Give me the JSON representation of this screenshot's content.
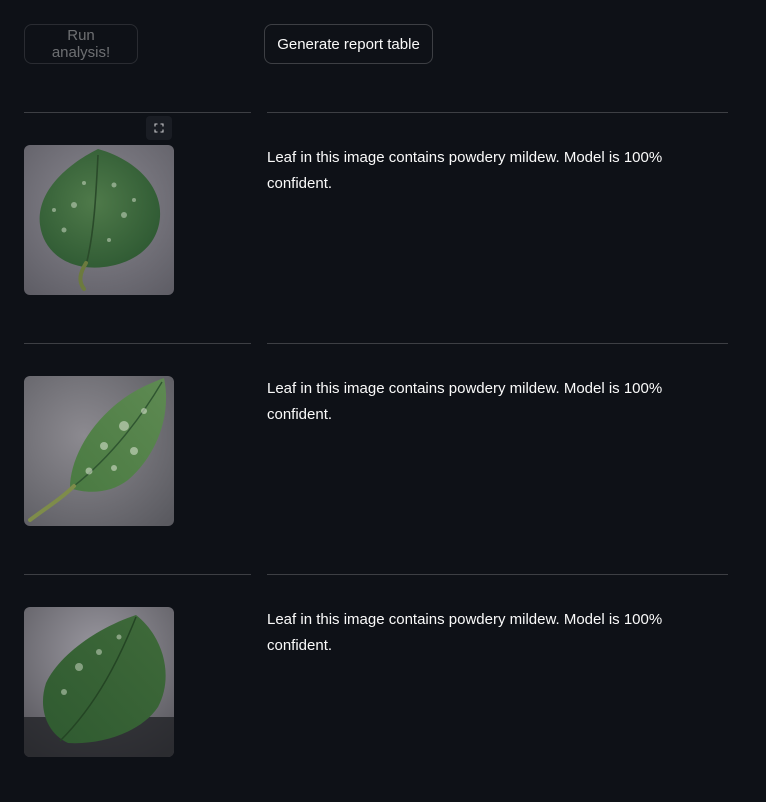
{
  "toolbar": {
    "run_label": "Run analysis!",
    "report_label": "Generate report table"
  },
  "results": [
    {
      "text": "Leaf in this image contains powdery mildew. Model is 100% confident.",
      "image_icon": "leaf-image"
    },
    {
      "text": "Leaf in this image contains powdery mildew. Model is 100% confident.",
      "image_icon": "leaf-image"
    },
    {
      "text": "Leaf in this image contains powdery mildew. Model is 100% confident.",
      "image_icon": "leaf-image"
    }
  ],
  "colors": {
    "background": "#0e1117",
    "text": "#fafafa",
    "leaf": "#3f6b3f",
    "photo_backdrop": "#7b7a80"
  }
}
